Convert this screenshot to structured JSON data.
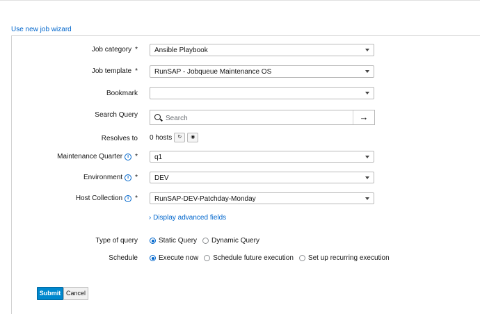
{
  "wizard_link": "Use new job wizard",
  "form": {
    "job_category": {
      "label": "Job category",
      "required": "*",
      "value": "Ansible Playbook"
    },
    "job_template": {
      "label": "Job template",
      "required": "*",
      "value": "RunSAP - Jobqueue Maintenance OS"
    },
    "bookmark": {
      "label": "Bookmark",
      "value": ""
    },
    "search_query": {
      "label": "Search Query",
      "placeholder": "Search"
    },
    "resolves_to": {
      "label": "Resolves to",
      "value": "0 hosts"
    },
    "maintenance_quarter": {
      "label": "Maintenance Quarter",
      "required": "*",
      "value": "q1"
    },
    "environment": {
      "label": "Environment",
      "required": "*",
      "value": "DEV"
    },
    "host_collection": {
      "label": "Host Collection",
      "required": "*",
      "value": "RunSAP-DEV-Patchday-Monday"
    },
    "advanced_link": "Display advanced fields",
    "type_of_query": {
      "label": "Type of query",
      "options": [
        "Static Query",
        "Dynamic Query"
      ],
      "selected": "Static Query"
    },
    "schedule": {
      "label": "Schedule",
      "options": [
        "Execute now",
        "Schedule future execution",
        "Set up recurring execution"
      ],
      "selected": "Execute now"
    }
  },
  "buttons": {
    "submit": "Submit",
    "cancel": "Cancel"
  },
  "icons": {
    "search": "search-icon",
    "go": "arrow-right-icon",
    "refresh": "refresh-icon",
    "preview": "eye-icon",
    "info": "info-icon",
    "caret": "chevron-down-icon"
  },
  "colors": {
    "link": "#0066cc",
    "primary_button": "#0088ce"
  }
}
